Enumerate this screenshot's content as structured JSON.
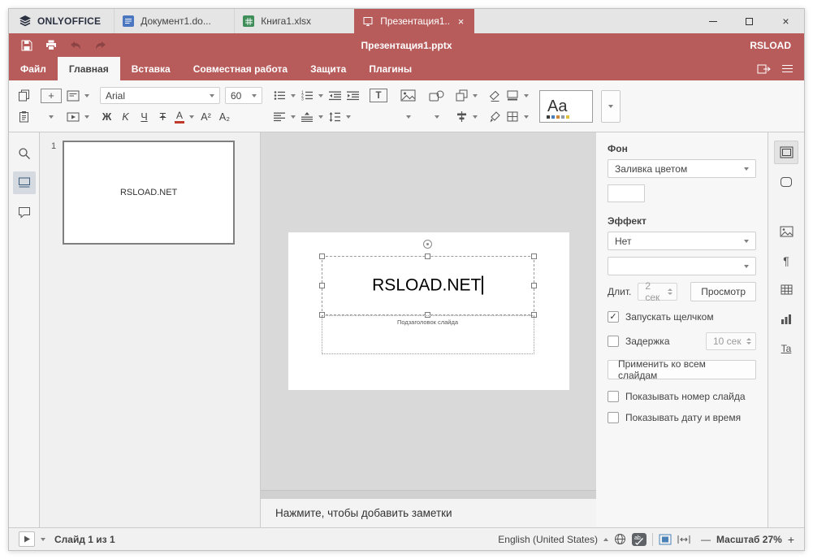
{
  "colors": {
    "accent_red": "#b75b5b",
    "canvas_bg": "#d9d9d9",
    "doc_blue": "#4a77c0",
    "sheet_green": "#3f8e5a"
  },
  "window": {
    "brand": "ONLYOFFICE",
    "tabs": [
      {
        "label": "Документ1.do..."
      },
      {
        "label": "Книга1.xlsx"
      },
      {
        "label": "Презентация1...",
        "close": "×"
      }
    ],
    "controls": {
      "close": "×"
    }
  },
  "titlebar": {
    "title": "Презентация1.pptx",
    "user": "RSLOAD"
  },
  "menubar": {
    "items": [
      "Файл",
      "Главная",
      "Вставка",
      "Совместная работа",
      "Защита",
      "Плагины"
    ]
  },
  "toolbar": {
    "font_name": "Arial",
    "font_size": "60",
    "glyphs": {
      "bold": "Ж",
      "italic": "K",
      "underline": "Ч",
      "strikethrough": "Ŧ",
      "font_color": "A",
      "superscript": "A²",
      "subscript": "A₂",
      "textbox": "T",
      "theme": "Aa",
      "plus": "+"
    },
    "theme_colors": [
      "#3b3b3b",
      "#4a7ebb",
      "#d2883a",
      "#8f9aa7",
      "#dfc13d"
    ]
  },
  "slides_panel": {
    "slides": [
      {
        "number": "1",
        "title": "RSLOAD.NET"
      }
    ]
  },
  "canvas": {
    "title_text": "RSLOAD.NET",
    "subtitle_placeholder": "Подзаголовок слайда"
  },
  "notes": {
    "placeholder": "Нажмите, чтобы добавить заметки"
  },
  "right_panel": {
    "background_label": "Фон",
    "fill_type": "Заливка цветом",
    "effect_label": "Эффект",
    "effect_value": "Нет",
    "duration_label": "Длит.",
    "duration_value": "2 сек",
    "preview_button": "Просмотр",
    "start_on_click_label": "Запускать щелчком",
    "check_glyph": "✓",
    "delay_label": "Задержка",
    "delay_value": "10 сек",
    "apply_all_button": "Применить ко всем слайдам",
    "show_slide_number_label": "Показывать номер слайда",
    "show_date_time_label": "Показывать дату и время"
  },
  "right_rail": {
    "paragraph_glyph": "¶",
    "textart_glyph": "Ta"
  },
  "statusbar": {
    "slide_counter": "Слайд 1 из 1",
    "language": "English (United States)",
    "zoom_label": "Масштаб 27%",
    "zoom_out": "—",
    "zoom_in": "+"
  }
}
